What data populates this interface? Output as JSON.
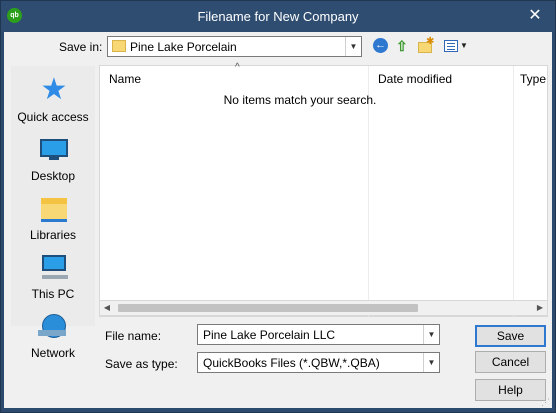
{
  "window": {
    "title": "Filename for New Company",
    "logo_text": "qb",
    "close_glyph": "✕"
  },
  "toolbar": {
    "save_in_label": "Save in:",
    "save_in_value": "Pine Lake Porcelain",
    "icons": [
      "back-icon",
      "up-folder-icon",
      "new-folder-icon",
      "views-menu-icon"
    ]
  },
  "places": [
    {
      "label": "Quick access",
      "icon": "star-icon"
    },
    {
      "label": "Desktop",
      "icon": "desktop-icon"
    },
    {
      "label": "Libraries",
      "icon": "libraries-icon"
    },
    {
      "label": "This PC",
      "icon": "pc-icon"
    },
    {
      "label": "Network",
      "icon": "network-icon"
    }
  ],
  "file_list": {
    "columns": [
      "Name",
      "Date modified",
      "Type"
    ],
    "sorted_by": "Name",
    "empty_message": "No items match your search."
  },
  "form": {
    "file_name_label": "File name:",
    "file_name_value": "Pine Lake Porcelain LLC",
    "save_as_type_label": "Save as type:",
    "save_as_type_value": "QuickBooks Files (*.QBW,*.QBA)"
  },
  "buttons": {
    "save": "Save",
    "cancel": "Cancel",
    "help": "Help"
  },
  "colors": {
    "titlebar": "#2e4d71",
    "accent_blue": "#2f78d0",
    "qb_green": "#2ca01c"
  }
}
